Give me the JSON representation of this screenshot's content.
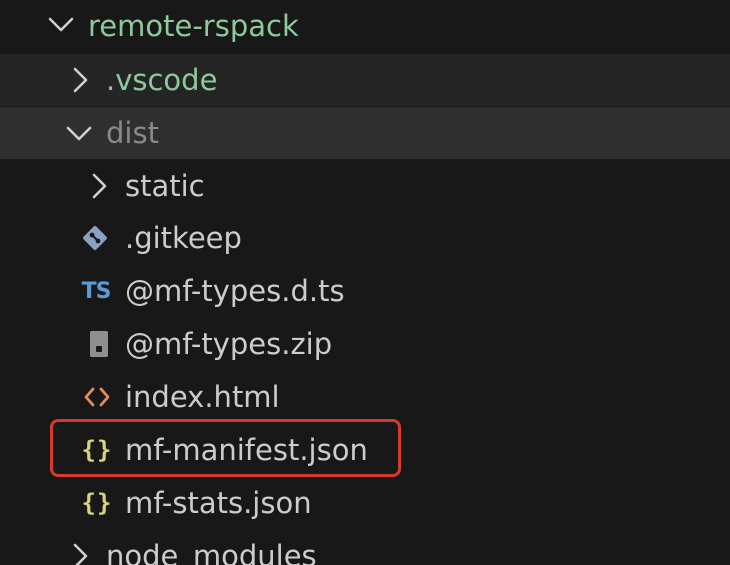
{
  "explorer": {
    "root": {
      "label": "remote-rspack",
      "expanded": true
    },
    "items": [
      {
        "label": ".vscode",
        "kind": "folder",
        "expanded": false
      },
      {
        "label": "dist",
        "kind": "folder",
        "expanded": true
      },
      {
        "label": "static",
        "kind": "folder",
        "expanded": false
      },
      {
        "label": ".gitkeep",
        "kind": "file",
        "icon": "git-icon"
      },
      {
        "label": "@mf-types.d.ts",
        "kind": "file",
        "icon": "typescript-icon",
        "icon_text": "TS"
      },
      {
        "label": "@mf-types.zip",
        "kind": "file",
        "icon": "zip-icon"
      },
      {
        "label": "index.html",
        "kind": "file",
        "icon": "html-icon"
      },
      {
        "label": "mf-manifest.json",
        "kind": "file",
        "icon": "json-icon",
        "icon_text": "{}",
        "highlighted": true
      },
      {
        "label": "mf-stats.json",
        "kind": "file",
        "icon": "json-icon",
        "icon_text": "{}"
      },
      {
        "label": "node_modules",
        "kind": "folder",
        "expanded": false
      }
    ]
  },
  "colors": {
    "background": "#181818",
    "folder_text": "#8ec99a",
    "file_text": "#cccccc",
    "highlight_border": "#d6392f",
    "json_icon": "#d8d47a",
    "ts_icon": "#5b9bd5",
    "html_icon": "#e0915a"
  }
}
